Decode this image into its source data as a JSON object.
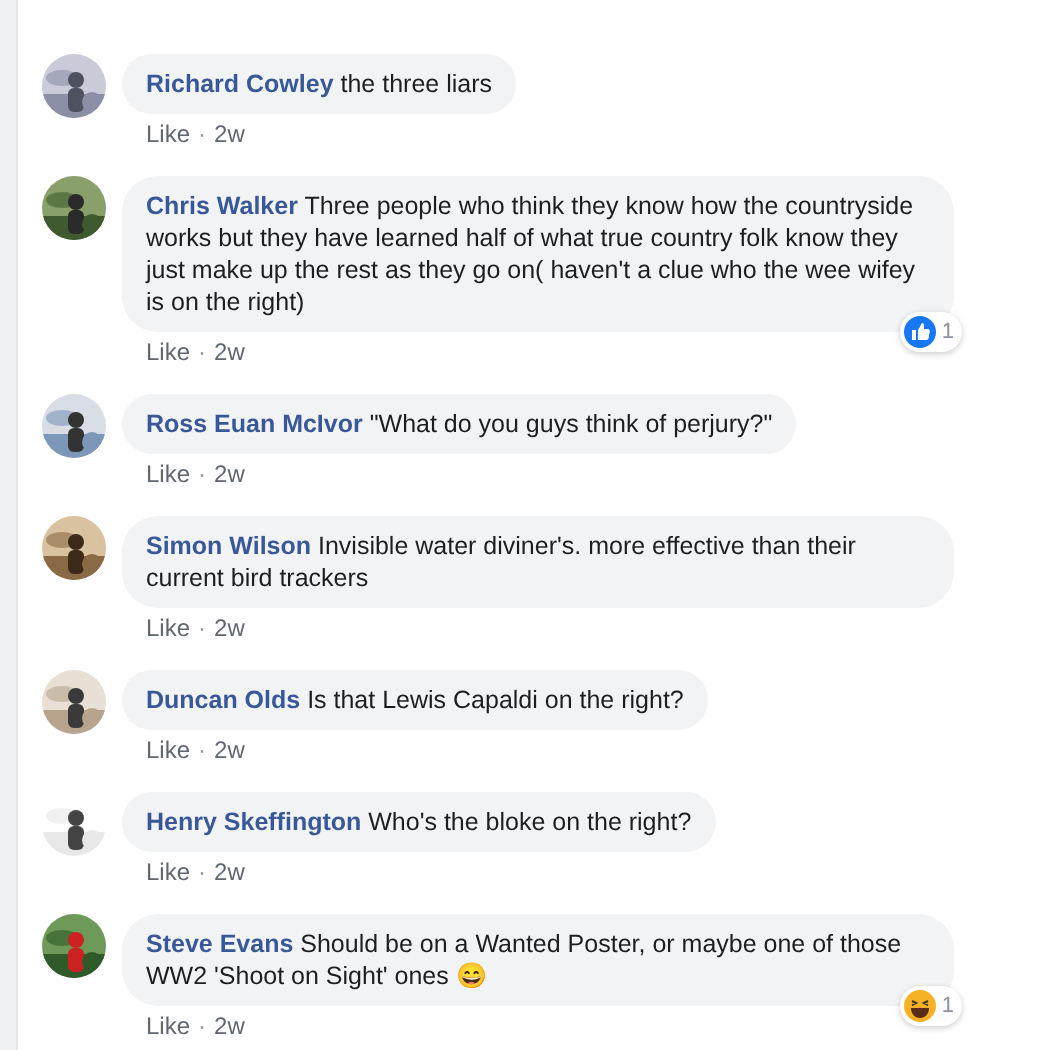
{
  "separator": "·",
  "comments": [
    {
      "author": "Richard Cowley",
      "text": "the three liars",
      "like": "Like",
      "time": "2w"
    },
    {
      "author": "Chris Walker",
      "text": "Three people who think they know how the countryside works but they have learned half of what true country folk know they just make up the rest as they go on( haven't a clue who the wee wifey is on the right)",
      "like": "Like",
      "time": "2w",
      "reaction": {
        "kind": "like",
        "count": "1"
      }
    },
    {
      "author": "Ross Euan McIvor",
      "text": "\"What do you guys think of perjury?\"",
      "like": "Like",
      "time": "2w"
    },
    {
      "author": "Simon Wilson",
      "text": "Invisible water diviner's. more effective than their current bird trackers",
      "like": "Like",
      "time": "2w"
    },
    {
      "author": "Duncan Olds",
      "text": "Is that Lewis Capaldi on the right?",
      "like": "Like",
      "time": "2w"
    },
    {
      "author": "Henry Skeffington",
      "text": "Who's the bloke on the right?",
      "like": "Like",
      "time": "2w"
    },
    {
      "author": "Steve Evans",
      "text": "Should be on a Wanted Poster, or maybe one of those WW2 'Shoot on Sight' ones 😄",
      "like": "Like",
      "time": "2w",
      "reaction": {
        "kind": "haha",
        "count": "1"
      }
    }
  ]
}
